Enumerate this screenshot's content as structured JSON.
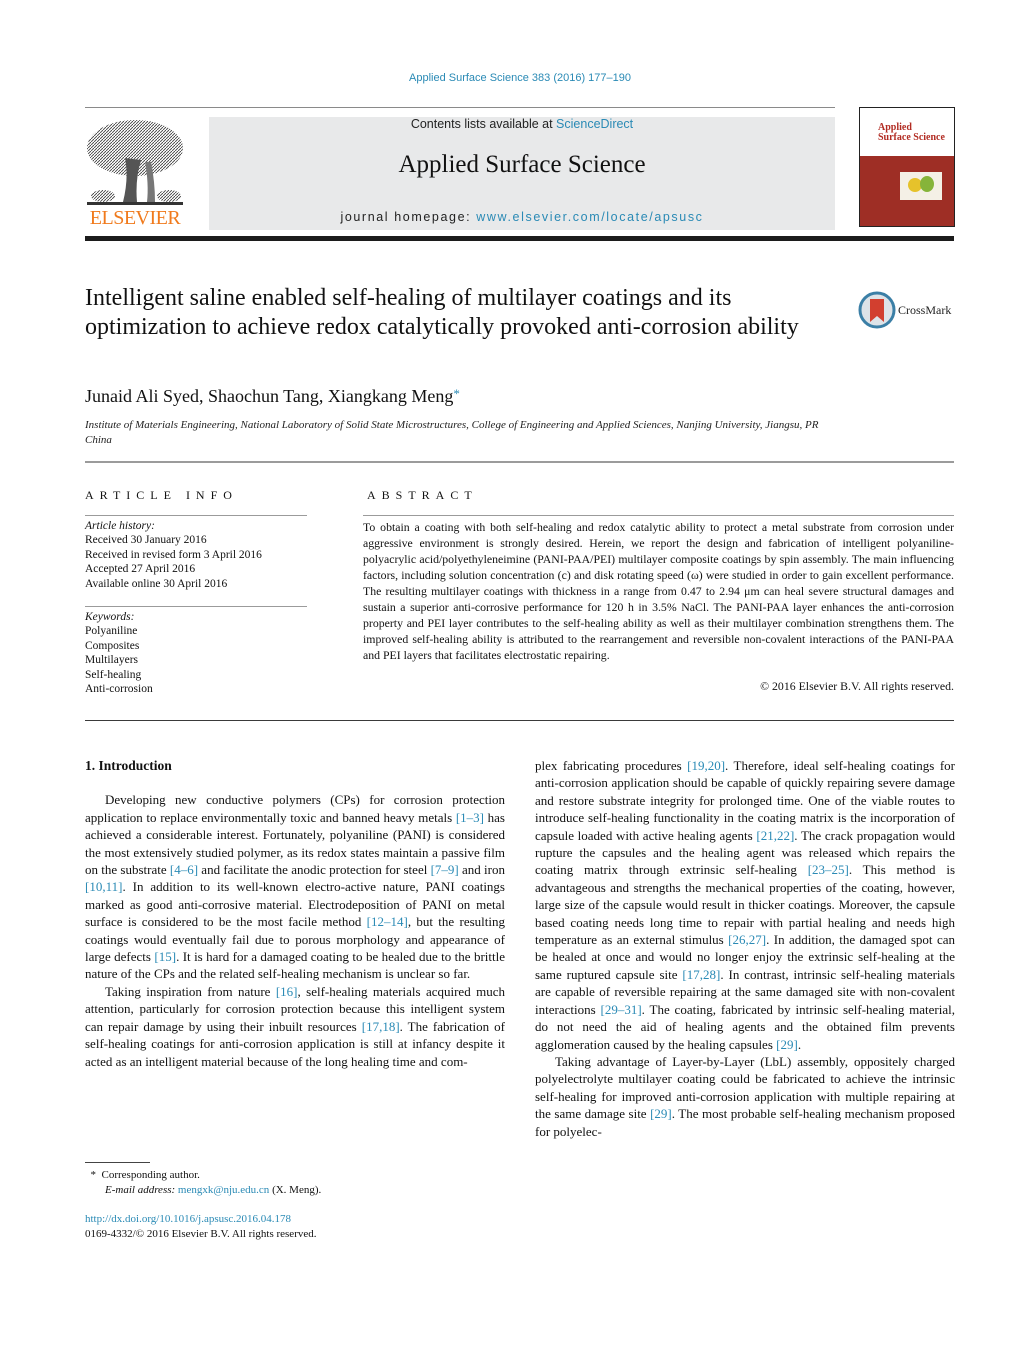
{
  "header": {
    "citation": "Applied Surface Science 383 (2016) 177–190",
    "contents_prefix": "Contents lists available at ",
    "contents_link": "ScienceDirect",
    "journal_name": "Applied Surface Science",
    "homepage_prefix": "journal homepage: ",
    "homepage_link": "www.elsevier.com/locate/apsusc",
    "publisher_logo_text": "ELSEVIER",
    "cover_title_line1": "Applied",
    "cover_title_line2": "Surface Science",
    "colors": {
      "link": "#2a8ab5",
      "elsevier_orange": "#f07a1c",
      "cover_red": "#9e2e25",
      "masthead_bg": "#e8e9ea"
    }
  },
  "article": {
    "title": "Intelligent saline enabled self-healing of multilayer coatings and its optimization to achieve redox catalytically provoked anti-corrosion ability",
    "crossmark_label": "CrossMark",
    "authors": "Junaid Ali Syed, Shaochun Tang, Xiangkang Meng",
    "author_mark": "*",
    "affiliation": "Institute of Materials Engineering, National Laboratory of Solid State Microstructures, College of Engineering and Applied Sciences, Nanjing University, Jiangsu, PR China"
  },
  "article_info": {
    "heading": "ARTICLE INFO",
    "history_label": "Article history:",
    "history": [
      "Received 30 January 2016",
      "Received in revised form 3 April 2016",
      "Accepted 27 April 2016",
      "Available online 30 April 2016"
    ],
    "keywords_label": "Keywords:",
    "keywords": [
      "Polyaniline",
      "Composites",
      "Multilayers",
      "Self-healing",
      "Anti-corrosion"
    ]
  },
  "abstract": {
    "heading": "ABSTRACT",
    "text": "To obtain a coating with both self-healing and redox catalytic ability to protect a metal substrate from corrosion under aggressive environment is strongly desired. Herein, we report the design and fabrication of intelligent polyaniline-polyacrylic acid/polyethyleneimine (PANI-PAA/PEI) multilayer composite coatings by spin assembly. The main influencing factors, including solution concentration (c) and disk rotating speed (ω) were studied in order to gain excellent performance. The resulting multilayer coatings with thickness in a range from 0.47 to 2.94 μm can heal severe structural damages and sustain a superior anti-corrosive performance for 120 h in 3.5% NaCl. The PANI-PAA layer enhances the anti-corrosion property and PEI layer contributes to the self-healing ability as well as their multilayer combination strengthens them. The improved self-healing ability is attributed to the rearrangement and reversible non-covalent interactions of the PANI-PAA and PEI layers that facilitates electrostatic repairing.",
    "copyright": "© 2016 Elsevier B.V. All rights reserved."
  },
  "body": {
    "section_heading": "1.  Introduction",
    "left_paragraphs": [
      [
        {
          "t": "Developing new conductive polymers (CPs) for corrosion protection application to replace environmentally toxic and banned heavy metals "
        },
        {
          "ref": "[1–3]"
        },
        {
          "t": " has achieved a considerable interest. Fortunately, polyaniline (PANI) is considered the most extensively studied polymer, as its redox states maintain a passive film on the substrate "
        },
        {
          "ref": "[4–6]"
        },
        {
          "t": " and facilitate the anodic protection for steel "
        },
        {
          "ref": "[7–9]"
        },
        {
          "t": " and iron "
        },
        {
          "ref": "[10,11]"
        },
        {
          "t": ". In addition to its well-known electro-active nature, PANI coatings marked as good anti-corrosive material. Electrodeposition of PANI on metal surface is considered to be the most facile method "
        },
        {
          "ref": "[12–14]"
        },
        {
          "t": ", but the resulting coatings would eventually fail due to porous morphology and appearance of large defects "
        },
        {
          "ref": "[15]"
        },
        {
          "t": ". It is hard for a damaged coating to be healed due to the brittle nature of the CPs and the related self-healing mechanism is unclear so far."
        }
      ],
      [
        {
          "t": "Taking inspiration from nature "
        },
        {
          "ref": "[16]"
        },
        {
          "t": ", self-healing materials acquired much attention, particularly for corrosion protection because this intelligent system can repair damage by using their inbuilt resources "
        },
        {
          "ref": "[17,18]"
        },
        {
          "t": ". The fabrication of self-healing coatings for anti-corrosion application is still at infancy despite it acted as an intelligent material because of the long healing time and com-"
        }
      ]
    ],
    "right_paragraphs": [
      [
        {
          "t": "plex fabricating procedures "
        },
        {
          "ref": "[19,20]"
        },
        {
          "t": ". Therefore, ideal self-healing coatings for anti-corrosion application should be capable of quickly repairing severe damage and restore substrate integrity for prolonged time. One of the viable routes to introduce self-healing functionality in the coating matrix is the incorporation of capsule loaded with active healing agents "
        },
        {
          "ref": "[21,22]"
        },
        {
          "t": ". The crack propagation would rupture the capsules and the healing agent was released which repairs the coating matrix through extrinsic self-healing "
        },
        {
          "ref": "[23–25]"
        },
        {
          "t": ". This method is advantageous and strengths the mechanical properties of the coating, however, large size of the capsule would result in thicker coatings. Moreover, the capsule based coating needs long time to repair with partial healing and needs high temperature as an external stimulus "
        },
        {
          "ref": "[26,27]"
        },
        {
          "t": ". In addition, the damaged spot can be healed at once and would no longer enjoy the extrinsic self-healing at the same ruptured capsule site "
        },
        {
          "ref": "[17,28]"
        },
        {
          "t": ". In contrast, intrinsic self-healing materials are capable of reversible repairing at the same damaged site with non-covalent interactions "
        },
        {
          "ref": "[29–31]"
        },
        {
          "t": ". The coating, fabricated by intrinsic self-healing material, do not need the aid of healing agents and the obtained film prevents agglomeration caused by the healing capsules "
        },
        {
          "ref": "[29]"
        },
        {
          "t": "."
        }
      ],
      [
        {
          "t": "Taking advantage of Layer-by-Layer (LbL) assembly, oppositely charged polyelectrolyte multilayer coating could be fabricated to achieve the intrinsic self-healing for improved anti-corrosion application with multiple repairing at the same damage site "
        },
        {
          "ref": "[29]"
        },
        {
          "t": ". The most probable self-healing mechanism proposed for polyelec-"
        }
      ]
    ]
  },
  "footnote": {
    "mark": "*",
    "corresponding": "Corresponding author.",
    "email_label": "E-mail address: ",
    "email": "mengxk@nju.edu.cn",
    "email_suffix": " (X. Meng)."
  },
  "doi": {
    "link": "http://dx.doi.org/10.1016/j.apsusc.2016.04.178",
    "issn_line": "0169-4332/© 2016 Elsevier B.V. All rights reserved."
  }
}
